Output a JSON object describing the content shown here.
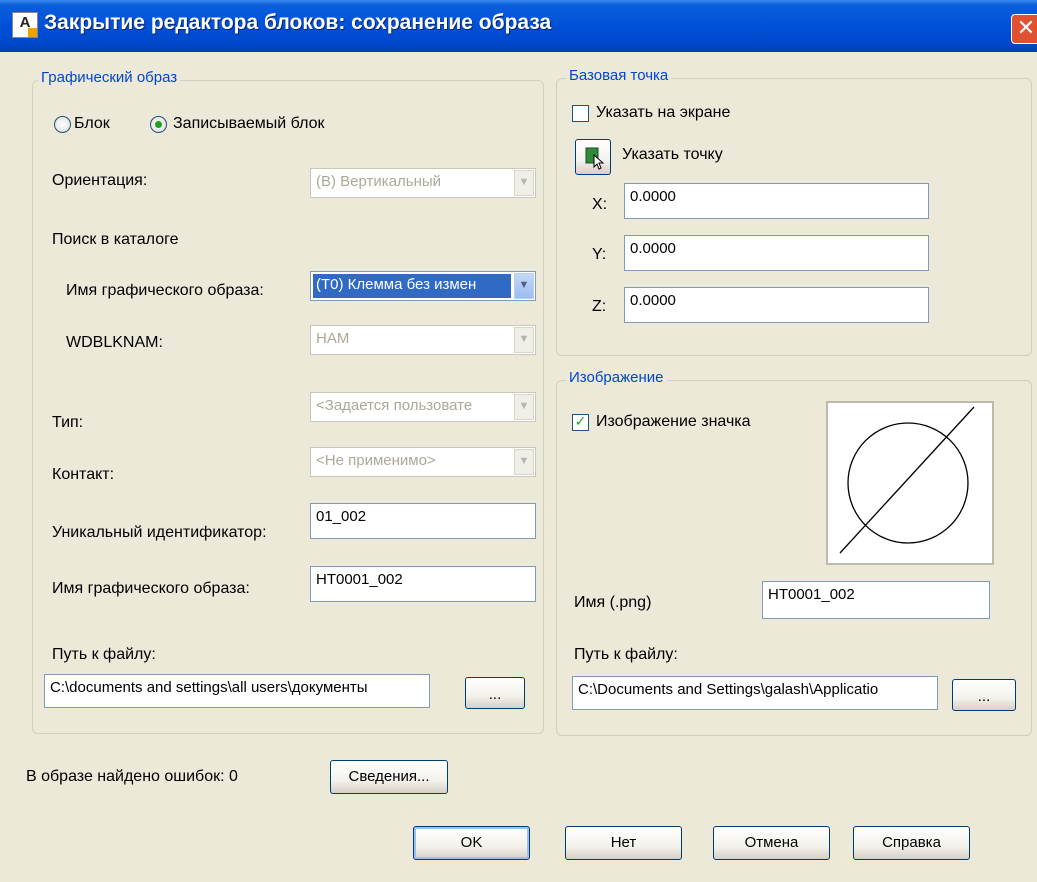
{
  "window": {
    "icon_letter": "A",
    "title": "Закрытие редактора блоков: сохранение образа",
    "close_glyph": "✕"
  },
  "graphic": {
    "legend": "Графический образ",
    "radio_block": "Блок",
    "radio_writable": "Записываемый блок",
    "orientation_label": "Ориентация:",
    "orientation_value": "(В) Вертикальный",
    "catalog_label": "Поиск в каталоге",
    "image_name_label": "Имя графического образа:",
    "image_name_combo": "(Т0) Клемма без измен",
    "wdblknam_label": "WDBLKNAM:",
    "wdblknam_value": "НАМ",
    "type_label": "Тип:",
    "type_value": "<Задается пользовате",
    "contact_label": "Контакт:",
    "contact_value": "<Не применимо>",
    "unique_id_label": "Уникальный идентификатор:",
    "unique_id_value": "01_002",
    "name_label": "Имя графического образа:",
    "name_value": "HT0001_002",
    "path_label": "Путь к файлу:",
    "path_value": "C:\\documents and settings\\all users\\документы",
    "browse": "..."
  },
  "base_point": {
    "legend": "Базовая точка",
    "specify_on_screen": "Указать на экране",
    "pick_point": "Указать точку",
    "x_label": "X:",
    "x_value": "0.0000",
    "y_label": "Y:",
    "y_value": "0.0000",
    "z_label": "Z:",
    "z_value": "0.0000"
  },
  "image": {
    "legend": "Изображение",
    "icon_checkbox": "Изображение значка",
    "png_name_label": "Имя (.png)",
    "png_name_value": "HT0001_002",
    "path_label": "Путь к файлу:",
    "path_value": "C:\\Documents and Settings\\galash\\Applicatio",
    "browse": "..."
  },
  "footer": {
    "errors_text": "В образе найдено ошибок: 0",
    "details_button": "Сведения...",
    "ok": "OK",
    "no": "Нет",
    "cancel": "Отмена",
    "help": "Справка"
  },
  "colors": {
    "title_bar": "#0050d8",
    "legend_text": "#0046d5",
    "dialog_bg": "#ece9d8",
    "selection": "#316ac5"
  },
  "icons": {
    "app": "autocad-electrical-icon",
    "close": "close-icon",
    "pick": "pick-point-icon",
    "combo_arrow": "chevron-down-icon"
  }
}
